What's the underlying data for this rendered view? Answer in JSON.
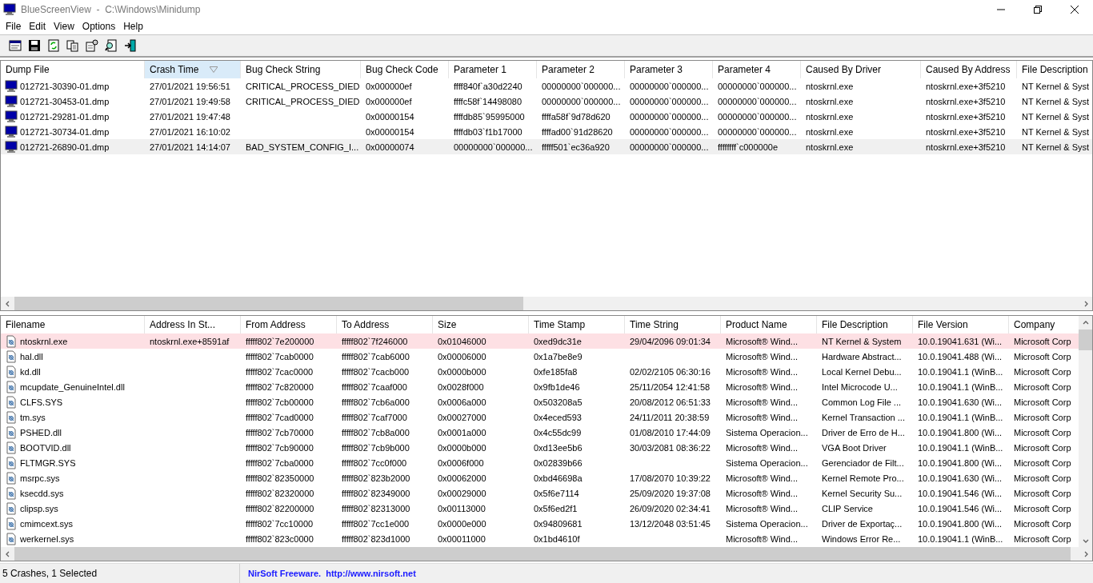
{
  "window": {
    "title": "BlueScreenView  -  C:\\Windows\\Minidump"
  },
  "menu": [
    "File",
    "Edit",
    "View",
    "Options",
    "Help"
  ],
  "crashes": {
    "columns": [
      {
        "label": "Dump File",
        "sorted": false
      },
      {
        "label": "Crash Time",
        "sorted": true
      },
      {
        "label": "Bug Check String",
        "sorted": false
      },
      {
        "label": "Bug Check Code",
        "sorted": false
      },
      {
        "label": "Parameter 1",
        "sorted": false
      },
      {
        "label": "Parameter 2",
        "sorted": false
      },
      {
        "label": "Parameter 3",
        "sorted": false
      },
      {
        "label": "Parameter 4",
        "sorted": false
      },
      {
        "label": "Caused By Driver",
        "sorted": false
      },
      {
        "label": "Caused By Address",
        "sorted": false
      },
      {
        "label": "File Description",
        "sorted": false
      }
    ],
    "rows": [
      {
        "selected": false,
        "cells": [
          "012721-30390-01.dmp",
          "27/01/2021 19:56:51",
          "CRITICAL_PROCESS_DIED",
          "0x000000ef",
          "ffff840f`a30d2240",
          "00000000`000000...",
          "00000000`000000...",
          "00000000`000000...",
          "ntoskrnl.exe",
          "ntoskrnl.exe+3f5210",
          "NT Kernel & Syst"
        ]
      },
      {
        "selected": false,
        "cells": [
          "012721-30453-01.dmp",
          "27/01/2021 19:49:58",
          "CRITICAL_PROCESS_DIED",
          "0x000000ef",
          "ffffc58f`14498080",
          "00000000`000000...",
          "00000000`000000...",
          "00000000`000000...",
          "ntoskrnl.exe",
          "ntoskrnl.exe+3f5210",
          "NT Kernel & Syst"
        ]
      },
      {
        "selected": false,
        "cells": [
          "012721-29281-01.dmp",
          "27/01/2021 19:47:48",
          "",
          "0x00000154",
          "ffffdb85`95995000",
          "ffffa58f`9d78d620",
          "00000000`000000...",
          "00000000`000000...",
          "ntoskrnl.exe",
          "ntoskrnl.exe+3f5210",
          "NT Kernel & Syst"
        ]
      },
      {
        "selected": false,
        "cells": [
          "012721-30734-01.dmp",
          "27/01/2021 16:10:02",
          "",
          "0x00000154",
          "ffffdb03`f1b17000",
          "ffffad00`91d28620",
          "00000000`000000...",
          "00000000`000000...",
          "ntoskrnl.exe",
          "ntoskrnl.exe+3f5210",
          "NT Kernel & Syst"
        ]
      },
      {
        "selected": true,
        "cells": [
          "012721-26890-01.dmp",
          "27/01/2021 14:14:07",
          "BAD_SYSTEM_CONFIG_I...",
          "0x00000074",
          "00000000`000000...",
          "fffff501`ec36a920",
          "00000000`000000...",
          "ffffffff`c000000e",
          "ntoskrnl.exe",
          "ntoskrnl.exe+3f5210",
          "NT Kernel & Syst"
        ]
      }
    ]
  },
  "drivers": {
    "columns": [
      "Filename",
      "Address In St...",
      "From Address",
      "To Address",
      "Size",
      "Time Stamp",
      "Time String",
      "Product Name",
      "File Description",
      "File Version",
      "Company"
    ],
    "rows": [
      {
        "highlighted": true,
        "cells": [
          "ntoskrnl.exe",
          "ntoskrnl.exe+8591af",
          "fffff802`7e200000",
          "fffff802`7f246000",
          "0x01046000",
          "0xed9dc31e",
          "29/04/2096 09:01:34",
          "Microsoft® Wind...",
          "NT Kernel & System",
          "10.0.19041.631 (Wi...",
          "Microsoft Corp"
        ]
      },
      {
        "highlighted": false,
        "cells": [
          "hal.dll",
          "",
          "fffff802`7cab0000",
          "fffff802`7cab6000",
          "0x00006000",
          "0x1a7be8e9",
          "",
          "Microsoft® Wind...",
          "Hardware Abstract...",
          "10.0.19041.488 (Wi...",
          "Microsoft Corp"
        ]
      },
      {
        "highlighted": false,
        "cells": [
          "kd.dll",
          "",
          "fffff802`7cac0000",
          "fffff802`7cacb000",
          "0x0000b000",
          "0xfe185fa8",
          "02/02/2105 06:30:16",
          "Microsoft® Wind...",
          "Local Kernel Debu...",
          "10.0.19041.1 (WinB...",
          "Microsoft Corp"
        ]
      },
      {
        "highlighted": false,
        "cells": [
          "mcupdate_GenuineIntel.dll",
          "",
          "fffff802`7c820000",
          "fffff802`7caaf000",
          "0x0028f000",
          "0x9fb1de46",
          "25/11/2054 12:41:58",
          "Microsoft® Wind...",
          "Intel Microcode U...",
          "10.0.19041.1 (WinB...",
          "Microsoft Corp"
        ]
      },
      {
        "highlighted": false,
        "cells": [
          "CLFS.SYS",
          "",
          "fffff802`7cb00000",
          "fffff802`7cb6a000",
          "0x0006a000",
          "0x503208a5",
          "20/08/2012 06:51:33",
          "Microsoft® Wind...",
          "Common Log File ...",
          "10.0.19041.630 (Wi...",
          "Microsoft Corp"
        ]
      },
      {
        "highlighted": false,
        "cells": [
          "tm.sys",
          "",
          "fffff802`7cad0000",
          "fffff802`7caf7000",
          "0x00027000",
          "0x4eced593",
          "24/11/2011 20:38:59",
          "Microsoft® Wind...",
          "Kernel Transaction ...",
          "10.0.19041.1 (WinB...",
          "Microsoft Corp"
        ]
      },
      {
        "highlighted": false,
        "cells": [
          "PSHED.dll",
          "",
          "fffff802`7cb70000",
          "fffff802`7cb8a000",
          "0x0001a000",
          "0x4c55dc99",
          "01/08/2010 17:44:09",
          "Sistema Operacion...",
          "Driver de Erro de H...",
          "10.0.19041.800 (Wi...",
          "Microsoft Corp"
        ]
      },
      {
        "highlighted": false,
        "cells": [
          "BOOTVID.dll",
          "",
          "fffff802`7cb90000",
          "fffff802`7cb9b000",
          "0x0000b000",
          "0xd13ee5b6",
          "30/03/2081 08:36:22",
          "Microsoft® Wind...",
          "VGA Boot Driver",
          "10.0.19041.1 (WinB...",
          "Microsoft Corp"
        ]
      },
      {
        "highlighted": false,
        "cells": [
          "FLTMGR.SYS",
          "",
          "fffff802`7cba0000",
          "fffff802`7cc0f000",
          "0x0006f000",
          "0x02839b66",
          "",
          "Sistema Operacion...",
          "Gerenciador de Filt...",
          "10.0.19041.800 (Wi...",
          "Microsoft Corp"
        ]
      },
      {
        "highlighted": false,
        "cells": [
          "msrpc.sys",
          "",
          "fffff802`82350000",
          "fffff802`823b2000",
          "0x00062000",
          "0xbd46698a",
          "17/08/2070 10:39:22",
          "Microsoft® Wind...",
          "Kernel Remote Pro...",
          "10.0.19041.630 (Wi...",
          "Microsoft Corp"
        ]
      },
      {
        "highlighted": false,
        "cells": [
          "ksecdd.sys",
          "",
          "fffff802`82320000",
          "fffff802`82349000",
          "0x00029000",
          "0x5f6e7114",
          "25/09/2020 19:37:08",
          "Microsoft® Wind...",
          "Kernel Security Su...",
          "10.0.19041.546 (Wi...",
          "Microsoft Corp"
        ]
      },
      {
        "highlighted": false,
        "cells": [
          "clipsp.sys",
          "",
          "fffff802`82200000",
          "fffff802`82313000",
          "0x00113000",
          "0x5f6ed2f1",
          "26/09/2020 02:34:41",
          "Microsoft® Wind...",
          "CLIP Service",
          "10.0.19041.546 (Wi...",
          "Microsoft Corp"
        ]
      },
      {
        "highlighted": false,
        "cells": [
          "cmimcext.sys",
          "",
          "fffff802`7cc10000",
          "fffff802`7cc1e000",
          "0x0000e000",
          "0x94809681",
          "13/12/2048 03:51:45",
          "Sistema Operacion...",
          "Driver de Exportaç...",
          "10.0.19041.800 (Wi...",
          "Microsoft Corp"
        ]
      },
      {
        "highlighted": false,
        "cells": [
          "werkernel.sys",
          "",
          "fffff802`823c0000",
          "fffff802`823d1000",
          "0x00011000",
          "0x1bd4610f",
          "",
          "Microsoft® Wind...",
          "Windows Error Re...",
          "10.0.19041.1 (WinB...",
          "Microsoft Corp"
        ]
      }
    ]
  },
  "status_bar": {
    "summary": "5 Crashes, 1 Selected",
    "link": "NirSoft Freeware.  http://www.nirsoft.net"
  }
}
